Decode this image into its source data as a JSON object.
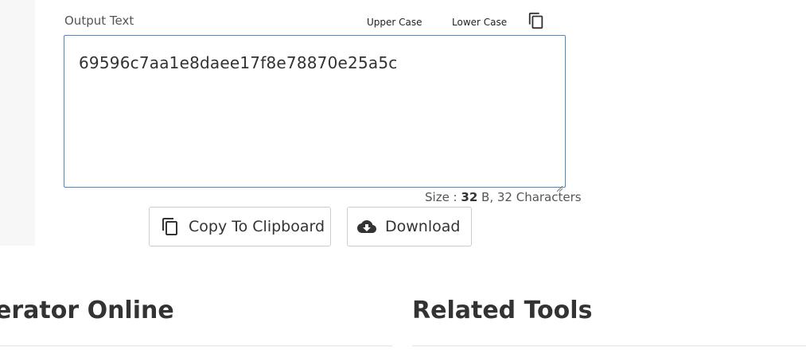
{
  "output": {
    "label": "Output Text",
    "upper_case_label": "Upper Case",
    "lower_case_label": "Lower Case",
    "value": "69596c7aa1e8daee17f8e78870e25a5c"
  },
  "size": {
    "prefix": "Size : ",
    "bytes": "32",
    "unit_and_chars": " B, 32 Characters"
  },
  "actions": {
    "copy_label": "Copy To Clipboard",
    "download_label": "Download"
  },
  "sections": {
    "left_title": "erator Online",
    "right_title": "Related Tools"
  },
  "icons": {
    "copy": "copy-icon",
    "download": "cloud-download-icon"
  },
  "colors": {
    "border_focus": "#4a88c7",
    "text": "#333333"
  }
}
